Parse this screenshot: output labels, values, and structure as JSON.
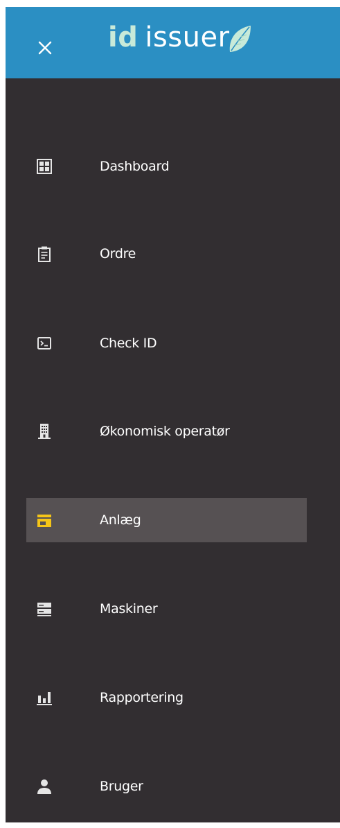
{
  "header": {
    "logo_id": "id",
    "logo_issuer": "issuer",
    "color": "#2b8fc3"
  },
  "colors": {
    "sidebar_bg": "#322e31",
    "active_bg": "#565153",
    "icon_default": "#e5e5e5",
    "icon_active": "#f5c518"
  },
  "menu": {
    "items": [
      {
        "label": "Dashboard",
        "icon": "dashboard-icon"
      },
      {
        "label": "Ordre",
        "icon": "clipboard-icon"
      },
      {
        "label": "Check ID",
        "icon": "terminal-icon"
      },
      {
        "label": "Økonomisk operatør",
        "icon": "building-icon"
      },
      {
        "label": "Anlæg",
        "icon": "store-icon",
        "active": true
      },
      {
        "label": "Maskiner",
        "icon": "server-icon"
      },
      {
        "label": "Rapportering",
        "icon": "bar-chart-icon"
      },
      {
        "label": "Bruger",
        "icon": "person-icon"
      }
    ]
  }
}
